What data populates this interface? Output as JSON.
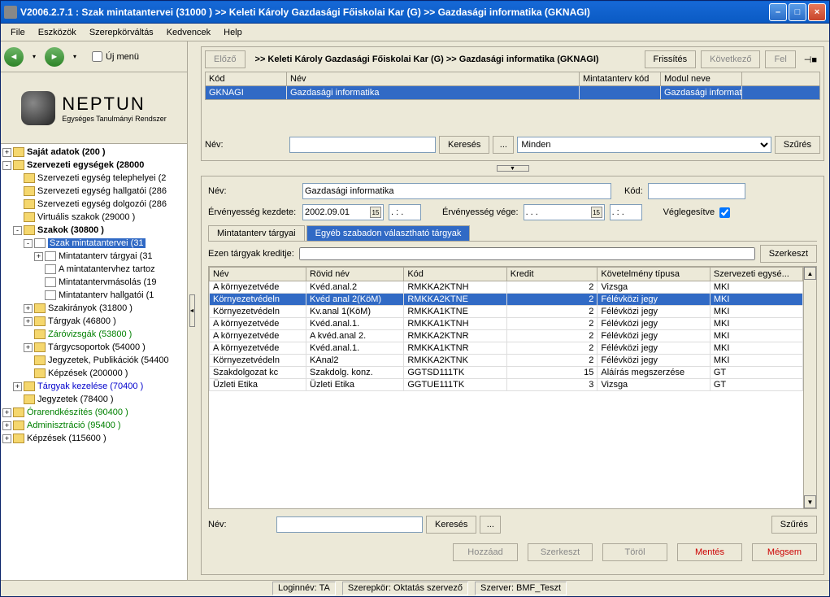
{
  "title": "V2006.2.7.1 : Szak mintatantervei (31000  )   >> Keleti Károly Gazdasági Főiskolai Kar (G) >> Gazdasági informatika (GKNAGI)",
  "menu": [
    "File",
    "Eszközök",
    "Szerepkörváltás",
    "Kedvencek",
    "Help"
  ],
  "nav": {
    "uj_menu": "Új menü"
  },
  "logo": {
    "name": "NEPTUN",
    "subtitle": "Egységes Tanulmányi Rendszer"
  },
  "tree": [
    {
      "depth": 0,
      "toggle": "+",
      "label": "Saját adatok (200  )",
      "bold": true
    },
    {
      "depth": 0,
      "toggle": "-",
      "label": "Szervezeti egységek (28000",
      "bold": true
    },
    {
      "depth": 1,
      "toggle": " ",
      "label": "Szervezeti egység telephelyei (2"
    },
    {
      "depth": 1,
      "toggle": " ",
      "label": "Szervezeti egység hallgatói (286"
    },
    {
      "depth": 1,
      "toggle": " ",
      "label": "Szervezeti egység dolgozói (286"
    },
    {
      "depth": 1,
      "toggle": " ",
      "label": "Virtuális szakok (29000  )"
    },
    {
      "depth": 1,
      "toggle": "-",
      "label": "Szakok (30800  )",
      "bold": true
    },
    {
      "depth": 2,
      "toggle": "-",
      "label": "Szak mintatantervei (31",
      "selected": true,
      "doc": true
    },
    {
      "depth": 3,
      "toggle": "+",
      "label": "Mintatanterv tárgyai (31",
      "doc": true
    },
    {
      "depth": 3,
      "toggle": " ",
      "label": "A mintatantervhez tartoz",
      "doc": true
    },
    {
      "depth": 3,
      "toggle": " ",
      "label": "Mintatantervmásolás (19",
      "doc": true
    },
    {
      "depth": 3,
      "toggle": " ",
      "label": "Mintatanterv hallgatói (1",
      "doc": true
    },
    {
      "depth": 2,
      "toggle": "+",
      "label": "Szakirányok (31800  )"
    },
    {
      "depth": 2,
      "toggle": "+",
      "label": "Tárgyak (46800  )"
    },
    {
      "depth": 2,
      "toggle": " ",
      "label": "Záróvizsgák (53800  )",
      "green": true
    },
    {
      "depth": 2,
      "toggle": "+",
      "label": "Tárgycsoportok (54000  )"
    },
    {
      "depth": 2,
      "toggle": " ",
      "label": "Jegyzetek, Publikációk (54400"
    },
    {
      "depth": 2,
      "toggle": " ",
      "label": "Képzések (200000  )"
    },
    {
      "depth": 1,
      "toggle": "+",
      "label": "Tárgyak kezelése (70400  )",
      "blue": true
    },
    {
      "depth": 1,
      "toggle": " ",
      "label": "Jegyzetek (78400  )"
    },
    {
      "depth": 0,
      "toggle": "+",
      "label": "Órarendkészítés (90400  )",
      "green": true
    },
    {
      "depth": 0,
      "toggle": "+",
      "label": "Adminisztráció (95400  )",
      "green": true
    },
    {
      "depth": 0,
      "toggle": "+",
      "label": "Képzések (115600  )"
    }
  ],
  "toolbar": {
    "prev": "Előző",
    "breadcrumb": ">> Keleti Károly Gazdasági Főiskolai Kar (G) >> Gazdasági informatika (GKNAGI)",
    "refresh": "Frissítés",
    "next": "Következő",
    "up": "Fel"
  },
  "grid1": {
    "headers": [
      "Kód",
      "Név",
      "Mintatanterv kód",
      "Modul neve"
    ],
    "widths": [
      100,
      360,
      100,
      100
    ],
    "rows": [
      {
        "sel": true,
        "cells": [
          "GKNAGI",
          "Gazdasági informatika",
          "",
          "Gazdasági informatik"
        ]
      }
    ]
  },
  "search1": {
    "name_label": "Név:",
    "name_value": "",
    "search_btn": "Keresés",
    "more_btn": "...",
    "filter_value": "Minden",
    "szures_btn": "Szűrés"
  },
  "detail": {
    "name_label": "Név:",
    "name_value": "Gazdasági informatika",
    "kod_label": "Kód:",
    "kod_value": "",
    "erv_kezd_label": "Érvényesség kezdete:",
    "erv_kezd_value": "2002.09.01",
    "erv_kezd_time": ". : .",
    "erv_vege_label": "Érvényesség vége:",
    "erv_vege_value": ". . .",
    "erv_vege_time": ". : .",
    "vegleg_label": "Véglegesítve"
  },
  "tabs": {
    "t1": "Mintatanterv tárgyai",
    "t2": "Egyéb szabadon választható tárgyak"
  },
  "kredit": {
    "label": "Ezen tárgyak kreditje:",
    "value": "",
    "szerkeszt": "Szerkeszt"
  },
  "grid2": {
    "headers": [
      "Név",
      "Rövid név",
      "Kód",
      "Kredit",
      "Követelmény típusa",
      "Szervezeti egysé..."
    ],
    "widths": [
      96,
      96,
      102,
      90,
      100,
      92
    ],
    "rows": [
      {
        "cells": [
          "A környezetvéde",
          "Kvéd.anal.2",
          "RMKKA2KTNH",
          "2",
          "Vizsga",
          "MKI"
        ]
      },
      {
        "sel": true,
        "cells": [
          "Környezetvédeln",
          "Kvéd anal 2(KöM)",
          "RMKKA2KTNE",
          "2",
          "Félévközi jegy",
          "MKI"
        ]
      },
      {
        "cells": [
          "Környezetvédeln",
          "Kv.anal 1(KöM)",
          "RMKKA1KTNE",
          "2",
          "Félévközi jegy",
          "MKI"
        ]
      },
      {
        "cells": [
          "A környezetvéde",
          "Kvéd.anal.1.",
          "RMKKA1KTNH",
          "2",
          "Félévközi jegy",
          "MKI"
        ]
      },
      {
        "cells": [
          "A környezetvéde",
          "A kvéd.anal 2.",
          "RMKKA2KTNR",
          "2",
          "Félévközi jegy",
          "MKI"
        ]
      },
      {
        "cells": [
          "A környezetvéde",
          "Kvéd.anal.1.",
          "RMKKA1KTNR",
          "2",
          "Félévközi jegy",
          "MKI"
        ]
      },
      {
        "cells": [
          "Környezetvédeln",
          "KAnal2",
          "RMKKA2KTNK",
          "2",
          "Félévközi jegy",
          "MKI"
        ]
      },
      {
        "cells": [
          "Szakdolgozat kc",
          "Szakdolg. konz.",
          "GGTSD111TK",
          "15",
          "Aláírás megszerzése",
          "GT"
        ]
      },
      {
        "cells": [
          "Üzleti Etika",
          "Üzleti Etika",
          "GGTUE111TK",
          "3",
          "Vizsga",
          "GT"
        ]
      }
    ]
  },
  "search2": {
    "name_label": "Név:",
    "name_value": "",
    "search_btn": "Keresés",
    "more_btn": "...",
    "szures_btn": "Szűrés"
  },
  "actions": {
    "hozzaad": "Hozzáad",
    "szerkeszt": "Szerkeszt",
    "torol": "Töröl",
    "mentes": "Mentés",
    "megsem": "Mégsem"
  },
  "status": {
    "login": "Loginnév: TA",
    "role": "Szerepkör: Oktatás szervező",
    "server": "Szerver: BMF_Teszt"
  }
}
